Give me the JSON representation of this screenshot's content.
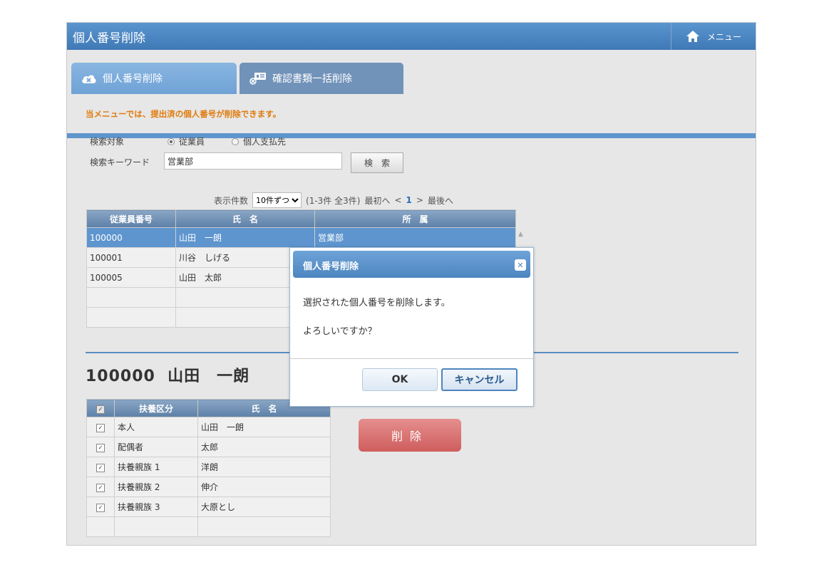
{
  "titlebar": {
    "title": "個人番号削除",
    "menu_label": "メニュー",
    "icon": "home-icon"
  },
  "tabs": [
    {
      "label": "個人番号削除",
      "icon": "cloud-x-icon",
      "active": true
    },
    {
      "label": "確認書類一括削除",
      "icon": "card-x-icon",
      "active": false
    }
  ],
  "notice": "当メニューでは、提出済の個人番号が削除できます。",
  "search": {
    "target_label": "検索対象",
    "options": [
      "従業員",
      "個人支払先"
    ],
    "selected": "従業員",
    "keyword_label": "検索キーワード",
    "keyword_value": "営業部",
    "button": "検　索"
  },
  "pager": {
    "count_label": "表示件数",
    "per_page": "10件ずつ",
    "summary": "(1-3件 全3件)",
    "first": "最初へ",
    "prev": "<",
    "current": "1",
    "next": ">",
    "last": "最後へ"
  },
  "employees": {
    "headers": [
      "従業員番号",
      "氏　名",
      "所　属"
    ],
    "rows": [
      [
        "100000",
        "山田　一朗",
        "営業部"
      ],
      [
        "100001",
        "川谷　しげる",
        ""
      ],
      [
        "100005",
        "山田　太郎",
        ""
      ],
      [
        "",
        "",
        ""
      ],
      [
        "",
        "",
        ""
      ]
    ],
    "selected_index": 0
  },
  "detail": {
    "title": "100000  山田　一朗",
    "headers": [
      "扶養区分",
      "氏　名"
    ],
    "rows": [
      [
        "本人",
        "山田　一朗"
      ],
      [
        "配偶者",
        "太郎"
      ],
      [
        "扶養親族 1",
        "洋朗"
      ],
      [
        "扶養親族 2",
        "伸介"
      ],
      [
        "扶養親族 3",
        "大原とし"
      ],
      [
        "",
        ""
      ]
    ],
    "delete_button": "削除"
  },
  "dialog": {
    "title": "個人番号削除",
    "message1": "選択された個人番号を削除します。",
    "message2": "よろしいですか？",
    "ok": "OK",
    "cancel": "キャンセル"
  },
  "colors": {
    "accent": "#4f86c1",
    "notice": "#e07b0b",
    "delete": "#d66666"
  }
}
